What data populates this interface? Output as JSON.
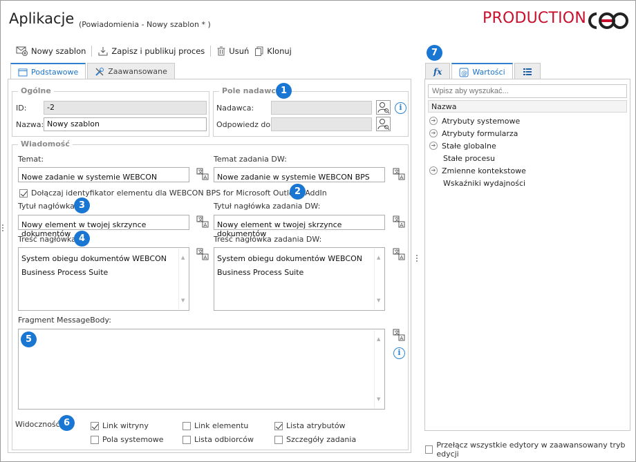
{
  "header": {
    "title": "Aplikacje",
    "subtitle": "(Powiadomienia  - Nowy szablon * )",
    "brand": "PRODUCTION"
  },
  "toolbar": {
    "new_template": "Nowy szablon",
    "save_publish": "Zapisz i publikuj proces",
    "delete": "Usuń",
    "clone": "Klonuj"
  },
  "tabs_left": {
    "basic": "Podstawowe",
    "advanced": "Zaawansowane"
  },
  "general": {
    "legend": "Ogólne",
    "id_label": "ID:",
    "id_value": "-2",
    "name_label": "Nazwa:",
    "name_value": "Nowy szablon"
  },
  "sender": {
    "legend": "Pole nadawcy",
    "sender_label": "Nadawca:",
    "sender_value": "",
    "reply_label": "Odpowiedz do:",
    "reply_value": ""
  },
  "message": {
    "legend": "Wiadomość",
    "subject_label": "Temat:",
    "subject_value": "Nowe zadanie w systemie WEBCON",
    "subject_dw_label": "Temat zadania DW:",
    "subject_dw_value": "Nowe zadanie w systemie WEBCON BPS",
    "attach_id_label": "Dołączaj identyfikator elementu dla WEBCON BPS for Microsoft Outlook AddIn",
    "attach_id_checked": true,
    "header_title_label": "Tytuł nagłówka:",
    "header_title_value": "Nowy element w twojej skrzynce dokumentów",
    "header_title_dw_label": "Tytuł nagłówka zadania DW:",
    "header_title_dw_value": "Nowy element w twojej skrzynce dokumentów",
    "header_content_label": "Treść nagłówka:",
    "header_content_line1": "System obiegu dokumentów WEBCON",
    "header_content_line2": "Business Process Suite",
    "header_content_dw_label": "Treść nagłówka zadania DW:",
    "header_content_dw_line1": "System obiegu dokumentów WEBCON",
    "header_content_dw_line2": "Business Process Suite",
    "fragment_label": "Fragment MessageBody:",
    "fragment_value": ""
  },
  "visibility": {
    "label": "Widoczność:",
    "items": [
      {
        "label": "Link witryny",
        "checked": true
      },
      {
        "label": "Link elementu",
        "checked": false
      },
      {
        "label": "Lista atrybutów",
        "checked": true
      },
      {
        "label": "Pola systemowe",
        "checked": false
      },
      {
        "label": "Lista odbiorców",
        "checked": false
      },
      {
        "label": "Szczegóły zadania",
        "checked": false
      }
    ]
  },
  "badges": [
    "1",
    "2",
    "3",
    "4",
    "5",
    "6",
    "7"
  ],
  "right_panel": {
    "tab_fx": "fx",
    "tab_values": "Wartości",
    "search_placeholder": "Wpisz aby wyszukać...",
    "column_header": "Nazwa",
    "tree": [
      {
        "label": "Atrybuty systemowe",
        "expandable": true
      },
      {
        "label": "Atrybuty formularza",
        "expandable": true
      },
      {
        "label": "Stałe globalne",
        "expandable": true
      },
      {
        "label": "Stałe procesu",
        "expandable": false
      },
      {
        "label": "Zmienne kontekstowe",
        "expandable": true
      },
      {
        "label": "Wskaźniki wydajności",
        "expandable": false
      }
    ],
    "advanced_mode_label": "Przełącz wszystkie edytory w zaawansowany tryb edycji"
  },
  "colors": {
    "brand": "#c8102e",
    "badge": "#1976d2",
    "active_tab": "#1a73c9"
  }
}
